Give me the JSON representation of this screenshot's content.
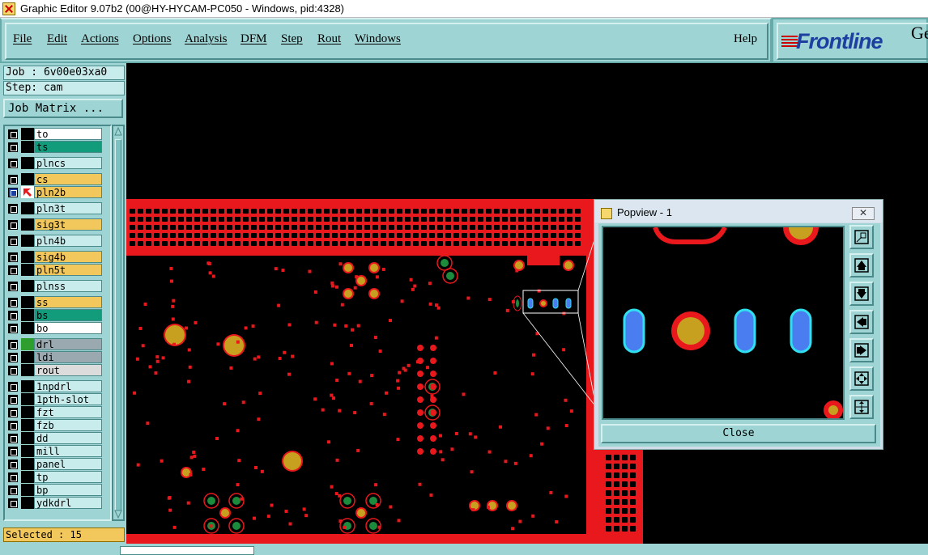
{
  "window": {
    "title": "Graphic Editor 9.07b2 (00@HY-HYCAM-PC050 - Windows, pid:4328)"
  },
  "menubar": {
    "items": [
      "File",
      "Edit",
      "Actions",
      "Options",
      "Analysis",
      "DFM",
      "Step",
      "Rout",
      "Windows"
    ],
    "help": "Help"
  },
  "brand": {
    "logo": "Frontline",
    "suffix": "Ge"
  },
  "job": {
    "job_label": "Job : 6v00e03xa0",
    "step_label": "Step: cam",
    "matrix_button": "Job Matrix ..."
  },
  "layers": [
    {
      "name": "to",
      "color": "#ffffff",
      "active": false
    },
    {
      "name": "ts",
      "color": "#139c7c",
      "active": false
    },
    {
      "name": "plncs",
      "color": "#c8ecec",
      "active": false
    },
    {
      "name": "cs",
      "color": "#f2c85c",
      "active": false
    },
    {
      "name": "pln2b",
      "color": "#f2c85c",
      "active": true
    },
    {
      "name": "pln3t",
      "color": "#c8ecec",
      "active": false
    },
    {
      "name": "sig3t",
      "color": "#f2c85c",
      "active": false
    },
    {
      "name": "pln4b",
      "color": "#c8ecec",
      "active": false
    },
    {
      "name": "sig4b",
      "color": "#f2c85c",
      "active": false
    },
    {
      "name": "pln5t",
      "color": "#f2c85c",
      "active": false
    },
    {
      "name": "plnss",
      "color": "#c8ecec",
      "active": false
    },
    {
      "name": "ss",
      "color": "#f2c85c",
      "active": false
    },
    {
      "name": "bs",
      "color": "#139c7c",
      "active": false
    },
    {
      "name": "bo",
      "color": "#ffffff",
      "active": false
    },
    {
      "name": "drl",
      "color": "#9aa8b0",
      "active": false
    },
    {
      "name": "ldi",
      "color": "#9aa8b0",
      "active": false
    },
    {
      "name": "rout",
      "color": "#dcdcdc",
      "active": false
    },
    {
      "name": "1npdrl",
      "color": "#c8ecec",
      "active": false
    },
    {
      "name": "1pth-slot",
      "color": "#c8ecec",
      "active": false
    },
    {
      "name": "fzt",
      "color": "#c8ecec",
      "active": false
    },
    {
      "name": "fzb",
      "color": "#c8ecec",
      "active": false
    },
    {
      "name": "dd",
      "color": "#c8ecec",
      "active": false
    },
    {
      "name": "mill",
      "color": "#c8ecec",
      "active": false
    },
    {
      "name": "panel",
      "color": "#c8ecec",
      "active": false
    },
    {
      "name": "tp",
      "color": "#c8ecec",
      "active": false
    },
    {
      "name": "bp",
      "color": "#c8ecec",
      "active": false
    },
    {
      "name": "ydkdrl",
      "color": "#c8ecec",
      "active": false
    }
  ],
  "selected": "Selected : 15",
  "popview": {
    "title": "Popview - 1",
    "close_label": "Close"
  },
  "colors": {
    "board": "#e8181c",
    "pad": "#c8a020",
    "via_ring": "#1c8c3c",
    "slot": "#4a7ef0",
    "slot_edge": "#30e0f0",
    "panel_bg": "#9ed4d4"
  }
}
